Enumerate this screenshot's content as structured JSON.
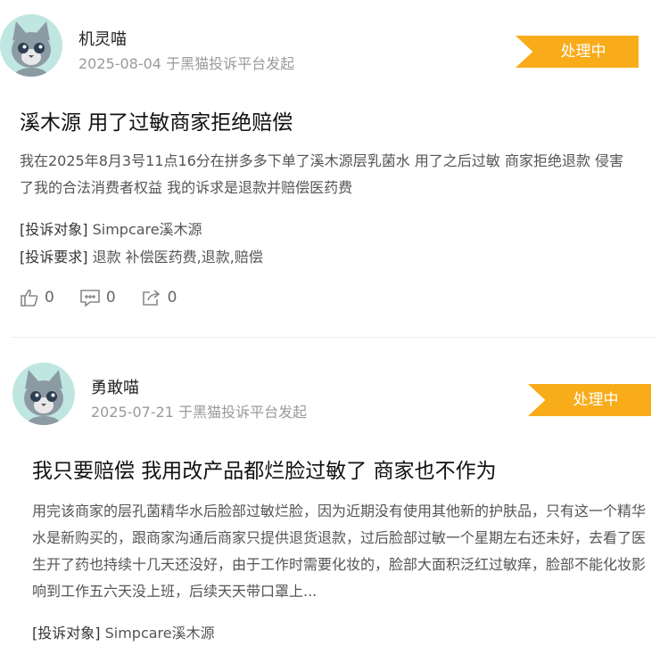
{
  "posts": [
    {
      "user": "机灵喵",
      "meta": "2025-08-04 于黑猫投诉平台发起",
      "status": "处理中",
      "title": "溪木源 用了过敏商家拒绝赔偿",
      "content": "我在2025年8月3号11点16分在拼多多下单了溪木源层乳菌水 用了之后过敏 商家拒绝退款 侵害了我的合法消费者权益 我的诉求是退款并赔偿医药费",
      "target_label": "[投诉对象]",
      "target_value": "Simpcare溪木源",
      "demand_label": "[投诉要求]",
      "demand_value": "退款 补偿医药费,退款,赔偿",
      "likes": "0",
      "comments": "0",
      "shares": "0"
    },
    {
      "user": "勇敢喵",
      "meta": "2025-07-21 于黑猫投诉平台发起",
      "status": "处理中",
      "title": "我只要赔偿 我用改产品都烂脸过敏了 商家也不作为",
      "content": "用完该商家的层孔菌精华水后脸部过敏烂脸，因为近期没有使用其他新的护肤品，只有这一个精华水是新购买的，跟商家沟通后商家只提供退货退款，过后脸部过敏一个星期左右还未好，去看了医生开了药也持续十几天还没好，由于工作时需要化妆的，脸部大面积泛红过敏痒，脸部不能化妆影响到工作五六天没上班，后续天天带口罩上...",
      "target_label": "[投诉对象]",
      "target_value": "Simpcare溪木源"
    }
  ],
  "colors": {
    "status_bg": "#f8ac1a",
    "avatar_bg": "#bfe6e0"
  },
  "icons": [
    "cat-avatar",
    "thumbs-up-icon",
    "comment-icon",
    "share-icon"
  ]
}
